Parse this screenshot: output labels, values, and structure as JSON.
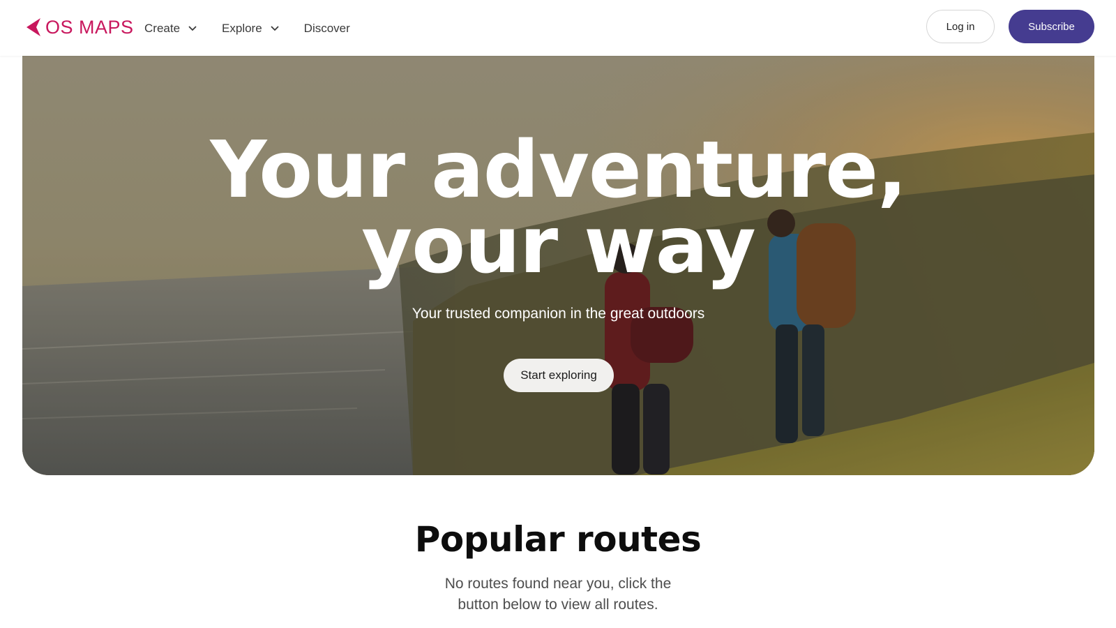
{
  "brand": {
    "logo_text": "OS MAPS",
    "logo_icon": "os-arrow-logo-icon",
    "color": "#c8175d"
  },
  "nav": {
    "items": [
      {
        "label": "Create",
        "has_dropdown": true,
        "icon": "chevron-down-icon"
      },
      {
        "label": "Explore",
        "has_dropdown": true,
        "icon": "chevron-down-icon"
      },
      {
        "label": "Discover",
        "has_dropdown": false
      }
    ]
  },
  "header_actions": {
    "login_label": "Log in",
    "subscribe_label": "Subscribe",
    "subscribe_color": "#453c90"
  },
  "hero": {
    "title_line1": "Your adventure,",
    "title_line2": "your way",
    "subtitle": "Your trusted companion in the great outdoors",
    "cta_label": "Start exploring",
    "image": "hikers-on-coastal-cliff-at-sunset"
  },
  "popular_routes": {
    "title": "Popular routes",
    "empty_message": "No routes found near you, click the button below to view all routes."
  }
}
